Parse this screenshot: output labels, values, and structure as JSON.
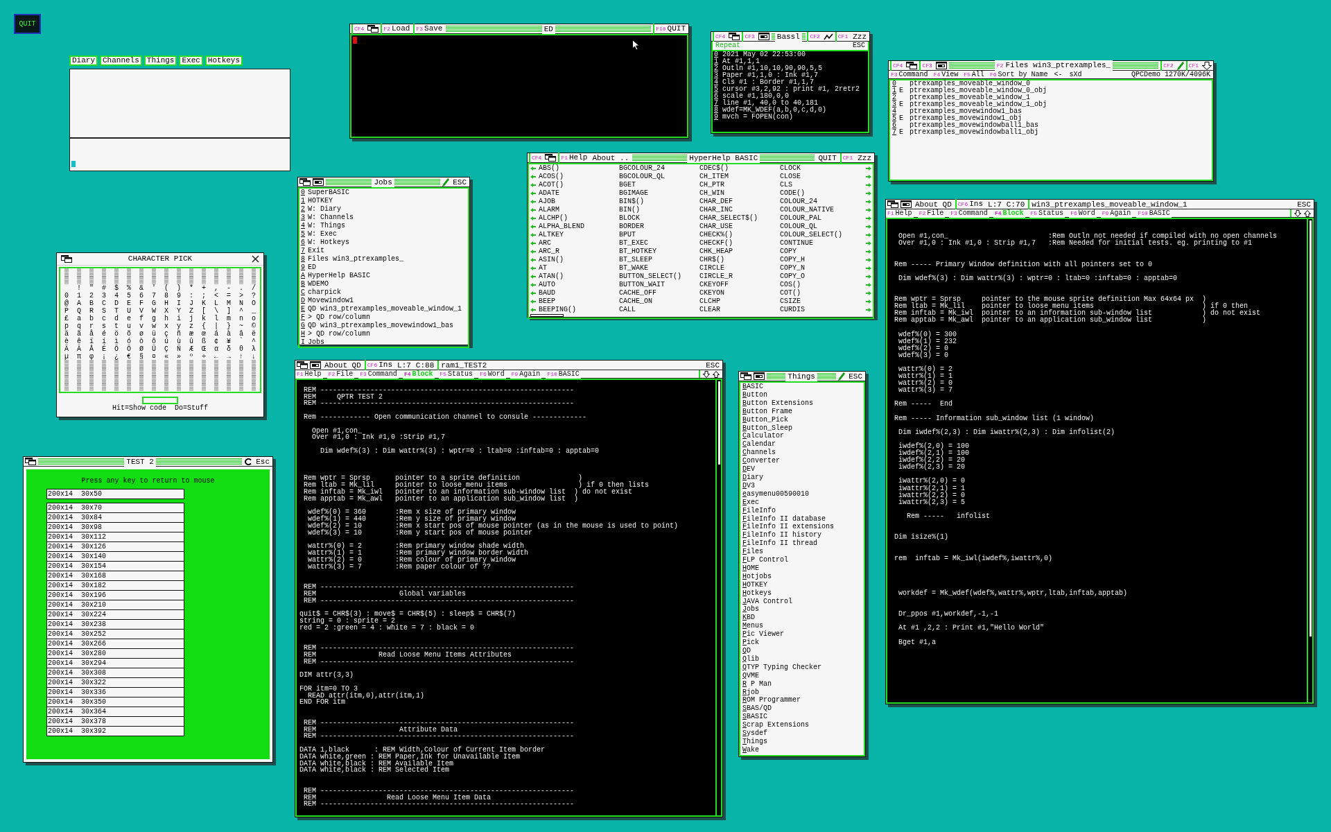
{
  "quit_button": {
    "label": "QUIT"
  },
  "diary_window": {
    "tabs": [
      "Diary",
      "Channels",
      "Things",
      "Exec",
      "Hotkeys"
    ]
  },
  "ed_window": {
    "header": [
      {
        "kind": "fkey",
        "key": "CF4"
      },
      {
        "kind": "wman"
      },
      {
        "kind": "fkey",
        "key": "F2",
        "label": "Load"
      },
      {
        "kind": "fkey",
        "key": "F3",
        "label": "Save"
      },
      {
        "kind": "title",
        "label": "ED"
      },
      {
        "kind": "fkey",
        "key": "F10",
        "label": "QUIT"
      }
    ]
  },
  "bassl_window": {
    "header": [
      {
        "kind": "fkey",
        "key": "CF4"
      },
      {
        "kind": "wman"
      },
      {
        "kind": "fkey",
        "key": "CF3"
      },
      {
        "kind": "card"
      },
      {
        "kind": "title",
        "label": "Bassl"
      },
      {
        "kind": "fkey",
        "key": "CF2"
      },
      {
        "kind": "resize"
      },
      {
        "kind": "fkey",
        "key": "CF1"
      },
      {
        "kind": "text",
        "label": "Zzz"
      }
    ],
    "subheader": {
      "label": "Repeat",
      "escape": "ESC"
    },
    "lines": [
      {
        "key": "0",
        "text": "2021 May 02 22:53:00"
      },
      {
        "key": "1",
        "text": "At #1,1,1"
      },
      {
        "key": "2",
        "text": "Outln #1,10,10,90,90,5,5"
      },
      {
        "key": "3",
        "text": "Paper #1,1,0 : Ink #1,7"
      },
      {
        "key": "4",
        "text": "Cls #1 : Border #1,1,7"
      },
      {
        "key": "5",
        "text": "cursor #3,2,92 : print #1, 2retr2"
      },
      {
        "key": "6",
        "text": "scale #1,180,0,0"
      },
      {
        "key": "7",
        "text": "line #1, 40,0 to 40,181"
      },
      {
        "key": "8",
        "text": "wdef=MK_WDEF(a,b,0,c,d,0)"
      },
      {
        "key": "9",
        "text": "mvch = FOPEN(con)"
      }
    ]
  },
  "files_window": {
    "header": [
      {
        "kind": "fkey",
        "key": "CF4"
      },
      {
        "kind": "wman"
      },
      {
        "kind": "fkey",
        "key": "CF3"
      },
      {
        "kind": "card"
      },
      {
        "kind": "title",
        "key": "F2",
        "label": "Files win3_ptrexamples_"
      },
      {
        "kind": "fkey",
        "key": "CF2"
      },
      {
        "kind": "pen"
      },
      {
        "kind": "fkey",
        "key": "CF1"
      },
      {
        "kind": "down"
      }
    ],
    "menu": [
      {
        "kind": "fkey",
        "key": "F3",
        "label": "Command"
      },
      {
        "kind": "fkey",
        "key": "F4",
        "label": "View"
      },
      {
        "kind": "fkey",
        "key": "F5",
        "label": "All"
      },
      {
        "kind": "fkey",
        "key": "F6",
        "label": "Sort by Name"
      },
      {
        "kind": "text",
        "label": "<-"
      },
      {
        "kind": "text",
        "label": "sXd"
      },
      {
        "kind": "text",
        "label": "QPCDemo 1270K/4096K"
      }
    ],
    "files": [
      {
        "key": "0",
        "name": "ptrexamples_moveable_window_0"
      },
      {
        "key": "1",
        "flag": "E",
        "name": "ptrexamples_moveable_window_0_obj"
      },
      {
        "key": "2",
        "name": "ptrexamples_moveable_window_1"
      },
      {
        "key": "3",
        "flag": "E",
        "name": "ptrexamples_moveable_window_1_obj"
      },
      {
        "key": "4",
        "name": "ptrexamples_movewindow1_bas"
      },
      {
        "key": "5",
        "flag": "E",
        "name": "ptrexamples_movewindow1_obj"
      },
      {
        "key": "6",
        "name": "ptrexamples_movewindowball1_bas"
      },
      {
        "key": "7",
        "flag": "E",
        "name": "ptrexamples_movewindowball1_obj"
      }
    ]
  },
  "hyperhelp_window": {
    "header": [
      {
        "kind": "fkey",
        "key": "CF4"
      },
      {
        "kind": "wman"
      },
      {
        "kind": "fkey",
        "key": "F1",
        "label": "Help"
      },
      {
        "kind": "text",
        "label": "About .."
      },
      {
        "kind": "title",
        "label": "HyperHelp BASIC"
      },
      {
        "kind": "text",
        "label": "QUIT"
      },
      {
        "kind": "fkey",
        "key": "CF1"
      },
      {
        "kind": "text",
        "label": "Zzz"
      }
    ],
    "rows": [
      [
        "ABS()",
        "BGCOLOUR_24",
        "CDEC$()",
        "CLOCK"
      ],
      [
        "ACOS()",
        "BGCOLOUR_QL",
        "CH_ITEM",
        "CLOSE"
      ],
      [
        "ACOT()",
        "BGET",
        "CH_PTR",
        "CLS"
      ],
      [
        "ADATE",
        "BGIMAGE",
        "CH_WIN",
        "CODE()"
      ],
      [
        "AJOB",
        "BIN$()",
        "CHAR_DEF",
        "COLOUR_24"
      ],
      [
        "ALARM",
        "BIN()",
        "CHAR_INC",
        "COLOUR_NATIVE"
      ],
      [
        "ALCHP()",
        "BLOCK",
        "CHAR_SELECT$()",
        "COLOUR_PAL"
      ],
      [
        "ALPHA_BLEND",
        "BORDER",
        "CHAR_USE",
        "COLOUR_QL"
      ],
      [
        "ALTKEY",
        "BPUT",
        "CHECK%()",
        "COLOUR_SELECT()"
      ],
      [
        "ARC",
        "BT_EXEC",
        "CHECKF()",
        "CONTINUE"
      ],
      [
        "ARC_R",
        "BT_HOTKEY",
        "CHK_HEAP",
        "COPY"
      ],
      [
        "ASIN()",
        "BT_SLEEP",
        "CHR$()",
        "COPY_H"
      ],
      [
        "AT",
        "BT_WAKE",
        "CIRCLE",
        "COPY_N"
      ],
      [
        "ATAN()",
        "BUTTON_SELECT()",
        "CIRCLE_R",
        "COPY_O"
      ],
      [
        "AUTO",
        "BUTTON_WAIT",
        "CKEYOFF",
        "COS()"
      ],
      [
        "BAUD",
        "CACHE_OFF",
        "CKEYON",
        "COT()"
      ],
      [
        "BEEP",
        "CACHE_ON",
        "CLCHP",
        "CSIZE"
      ],
      [
        "BEEPING()",
        "CALL",
        "CLEAR",
        "CURDIS"
      ]
    ]
  },
  "jobs_window": {
    "header": [
      {
        "kind": "wman"
      },
      {
        "kind": "card"
      },
      {
        "kind": "title",
        "label": "Jobs"
      },
      {
        "kind": "pen"
      },
      {
        "kind": "text",
        "label": "ESC"
      }
    ],
    "jobs": [
      {
        "key": "0",
        "label": "SuperBASIC"
      },
      {
        "key": "1",
        "label": "HOTKEY"
      },
      {
        "key": "2",
        "label": "W: Diary"
      },
      {
        "key": "3",
        "label": "W: Channels"
      },
      {
        "key": "4",
        "label": "W: Things"
      },
      {
        "key": "5",
        "label": "W: Exec"
      },
      {
        "key": "6",
        "label": "W: Hotkeys"
      },
      {
        "key": "7",
        "label": "Exit"
      },
      {
        "key": "8",
        "label": "Files win3_ptrexamples_"
      },
      {
        "key": "9",
        "label": "ED"
      },
      {
        "key": "A",
        "label": "HyperHelp BASIC"
      },
      {
        "key": "B",
        "label": "WDEMO"
      },
      {
        "key": "C",
        "label": "charpick"
      },
      {
        "key": "D",
        "label": "Movewindow1"
      },
      {
        "key": "E",
        "label": "QD win3_ptrexamples_moveable_window_1"
      },
      {
        "key": "F",
        "label": "> QD row/column"
      },
      {
        "key": "G",
        "label": "QD win3_ptrexamples_movewindow1_bas"
      },
      {
        "key": "H",
        "label": "> QD row/column"
      },
      {
        "key": "I",
        "label": "Jobs"
      }
    ]
  },
  "charpick_window": {
    "title": "CHARACTER PICK",
    "rows": [
      "▒ ▒ ▒ ▒ ▒ ▒ ▒ ▒ ▒ ▒ ▒ ▒ ▒ ▒ ▒ ▒",
      "▒ ▒ ▒ ▒ ▒ ▒ ▒ ▒ ▒ ▒ ▒ ▒ ▒ ▒ ▒ ▒",
      "  ! \" # $ % & ' ( ) * + , - . /",
      "0 1 2 3 4 5 6 7 8 9 : ; < = > ?",
      "@ A B C D E F G H I J K L M N O",
      "P Q R S T U V W X Y Z [ \\ ] ^ _",
      "£ a b c d e f g h i j k l m n o",
      "p q r s t u v w x y z { | } ~ ©",
      "ä ã å é ö õ ø ü ç ñ æ œ á à â ë",
      "è ê ï í ì ó ò ô ú ù û ß ¢ ¥ ` ^",
      "Ä Ã Å É Ö Õ Ø Ü Ç Ñ Æ Œ α δ θ λ",
      "µ π φ ¡ ¿ € § ¤ « » º ÷ ← → ↑ ↓",
      "▒ ▒ ▒ ▒ ▒ ▒ ▒ ▒ ▒ ▒ ▒ ▒ ▒ ▒ ▒ ▒",
      "▒ ▒ ▒ ▒ ▒ ▒ ▒ ▒ ▒ ▒ ▒ ▒ ▒ ▒ ▒ ▒",
      "▒ ▒ ▒ ▒ ▒ ▒ ▒ ▒ ▒ ▒ ▒ ▒ ▒ ▒ ▒ ▒",
      "▒ ▒ ▒ ▒ ▒ ▒ ▒ ▒ ▒ ▒ ▒ ▒ ▒ ▒ ▒ ▒"
    ],
    "hint": "Hit=Show code  Do=Stuff"
  },
  "test2_window": {
    "header": [
      {
        "kind": "wman"
      },
      {
        "kind": "title",
        "label": "TEST 2"
      },
      {
        "kind": "refresh"
      },
      {
        "kind": "text",
        "label": "Esc"
      }
    ],
    "prompt": "Press any key to return to mouse",
    "top_items": [
      "200x14  30x50"
    ],
    "items": [
      "200x14  30x70",
      "200x14  30x84",
      "200x14  30x98",
      "200x14  30x112",
      "200x14  30x126",
      "200x14  30x140",
      "200x14  30x154",
      "200x14  30x168",
      "200x14  30x182",
      "200x14  30x196",
      "200x14  30x210",
      "200x14  30x224",
      "200x14  30x238",
      "200x14  30x252",
      "200x14  30x266",
      "200x14  30x280",
      "200x14  30x294",
      "200x14  30x308",
      "200x14  30x322",
      "200x14  30x336",
      "200x14  30x350",
      "200x14  30x364",
      "200x14  30x378",
      "200x14  30x392"
    ]
  },
  "things_window": {
    "header": [
      {
        "kind": "wman"
      },
      {
        "kind": "card"
      },
      {
        "kind": "title",
        "label": "Things"
      },
      {
        "kind": "pen"
      },
      {
        "kind": "text",
        "label": "ESC"
      }
    ],
    "things": [
      "BASIC",
      "Button",
      "Button Extensions",
      "Button Frame",
      "Button_Pick",
      "Button_Sleep",
      "Calculator",
      "Calendar",
      "Channels",
      "Converter",
      "DEV",
      "Diary",
      "DV3",
      "easymenu00590010",
      "Exec",
      "FileInfo",
      "FileInfo II database",
      "FileInfo II extensions",
      "FileInfo II history",
      "FileInfo II thread",
      "Files",
      "FLP Control",
      "HOME",
      "Hotjobs",
      "HOTKEY",
      "Hotkeys",
      "JAVA Control",
      "Jobs",
      "KBD",
      "Menus",
      "Pic Viewer",
      "Pick",
      "QD",
      "Qlib",
      "QTYP Typing Checker",
      "QVME",
      "R P Man",
      "Rjob",
      "ROM Programmer",
      "SBAS/QD",
      "SBASIC",
      "Scrap Extensions",
      "Sysdef",
      "Things",
      "Wake"
    ]
  },
  "editor_windows": [
    {
      "header": [
        {
          "kind": "wman"
        },
        {
          "kind": "card"
        },
        {
          "kind": "text",
          "label": "About QD"
        },
        {
          "kind": "fkey",
          "key": "CF6",
          "label": "Ins"
        },
        {
          "kind": "text",
          "label": "L:7"
        },
        {
          "kind": "text",
          "label": "C:88"
        },
        {
          "kind": "file",
          "label": "ram1_TEST2"
        },
        {
          "kind": "text",
          "label": "ESC"
        }
      ],
      "menu": [
        {
          "key": "F1",
          "label": "Help",
          "highlighted": false
        },
        {
          "key": "F2",
          "label": "File",
          "highlighted": false
        },
        {
          "key": "F3",
          "label": "Command",
          "highlighted": false
        },
        {
          "key": "F4",
          "label": "Block",
          "highlighted": true
        },
        {
          "key": "F5",
          "label": "Status",
          "highlighted": false
        },
        {
          "key": "F6",
          "label": "Word",
          "highlighted": false
        },
        {
          "key": "F9",
          "label": "Again",
          "highlighted": false
        },
        {
          "key": "F10",
          "label": "BASIC",
          "highlighted": false
        }
      ],
      "lines": [
        {
          "kind": "blank"
        },
        {
          "kind": "code",
          "text": " REM -------------------------------------------------------------"
        },
        {
          "kind": "code",
          "text": " REM     QPTR TEST 2"
        },
        {
          "kind": "code",
          "text": " REM -------------------------------------------------------------"
        },
        {
          "kind": "blank"
        },
        {
          "kind": "code",
          "text": " Rem ------------ Open communication channel to consule -------------"
        },
        {
          "kind": "blank"
        },
        {
          "kind": "code",
          "text": "   Open #1,con_"
        },
        {
          "kind": "code",
          "text": "   Over #1,0 : Ink #1,0 :Strip #1,7"
        },
        {
          "kind": "blank"
        },
        {
          "kind": "code",
          "text": "     Dim wdef%(3) : Dim wattr%(3) : wptr=0 : ltab=0 :inftab=0 : apptab=0"
        },
        {
          "kind": "blank"
        },
        {
          "kind": "blank"
        },
        {
          "kind": "blank"
        },
        {
          "kind": "code",
          "text": " Rem wptr = Sprsp      pointer to a sprite definition              )"
        },
        {
          "kind": "code",
          "text": " Rem ltab = Mk_lil     pointer to loose menu items                 ) if 0 then lists"
        },
        {
          "kind": "code",
          "text": " Rem inftab = Mk_iwl   pointer to an information sub-window list  ) do not exist"
        },
        {
          "kind": "code",
          "text": " Rem apptab = Mk_awl   pointer to an application sub_window list  )"
        },
        {
          "kind": "blank"
        },
        {
          "kind": "code",
          "text": "  wdef%(0) = 360       :Rem x size of primary window"
        },
        {
          "kind": "code",
          "text": "  wdef%(1) = 440       :Rem y size of primary window"
        },
        {
          "kind": "code",
          "text": "  wdef%(2) = 10        :Rem x start pos of mouse pointer (as in the mouse is used to point)"
        },
        {
          "kind": "code",
          "text": "  wdef%(3) = 10        :Rem y start pos of mouse pointer"
        },
        {
          "kind": "blank"
        },
        {
          "kind": "code",
          "text": "  wattr%(0) = 2        :Rem primary window shade width"
        },
        {
          "kind": "code",
          "text": "  wattr%(1) = 1        :Rem primary window border width"
        },
        {
          "kind": "code",
          "text": "  wattr%(2) = 0        :Rem colour of primary window"
        },
        {
          "kind": "code",
          "text": "  wattr%(3) = 7        :Rem paper colour of ??"
        },
        {
          "kind": "blank"
        },
        {
          "kind": "blank"
        },
        {
          "kind": "code",
          "text": " REM -------------------------------------------------------------"
        },
        {
          "kind": "code",
          "text": " REM                    Global variables"
        },
        {
          "kind": "code",
          "text": " REM -------------------------------------------------------------"
        },
        {
          "kind": "blank"
        },
        {
          "kind": "code",
          "text": "quit$ = CHR$(3) : move$ = CHR$(5) : sleep$ = CHR$(7)"
        },
        {
          "kind": "code",
          "text": "string = 0 : sprite = 2"
        },
        {
          "kind": "code",
          "text": "red = 2 :green = 4 : white = 7 : black = 0"
        },
        {
          "kind": "blank"
        },
        {
          "kind": "blank"
        },
        {
          "kind": "code",
          "text": " REM -------------------------------------------------------------"
        },
        {
          "kind": "code",
          "text": " REM               Read Loose Menu Items Attributes"
        },
        {
          "kind": "code",
          "text": " REM -------------------------------------------------------------"
        },
        {
          "kind": "blank"
        },
        {
          "kind": "code",
          "text": "DIM attr(3,3)"
        },
        {
          "kind": "blank"
        },
        {
          "kind": "code",
          "text": "FOR itm=0 TO 3"
        },
        {
          "kind": "code",
          "text": "  READ attr(itm,0),attr(itm,1)"
        },
        {
          "kind": "code",
          "text": "END FOR itm"
        },
        {
          "kind": "blank"
        },
        {
          "kind": "blank"
        },
        {
          "kind": "code",
          "text": " REM -------------------------------------------------------------"
        },
        {
          "kind": "code",
          "text": " REM                    Attribute Data"
        },
        {
          "kind": "code",
          "text": " REM -------------------------------------------------------------"
        },
        {
          "kind": "blank"
        },
        {
          "kind": "code",
          "text": "DATA 1,black      : REM Width,Colour of Current Item border"
        },
        {
          "kind": "code",
          "text": "DATA white,green : REM Paper,Ink for Unavailable Item"
        },
        {
          "kind": "code",
          "text": "DATA white,black : REM Available Item"
        },
        {
          "kind": "code",
          "text": "DATA white,black : REM Selected Item"
        },
        {
          "kind": "blank"
        },
        {
          "kind": "blank"
        },
        {
          "kind": "code",
          "text": " REM -------------------------------------------------------------"
        },
        {
          "kind": "code",
          "text": " REM                 Read Loose Menu Item Data"
        },
        {
          "kind": "code",
          "text": " REM -------------------------------------------------------------"
        }
      ]
    },
    {
      "header": [
        {
          "kind": "wman"
        },
        {
          "kind": "card"
        },
        {
          "kind": "text",
          "label": "About QD"
        },
        {
          "kind": "fkey",
          "key": "CF6",
          "label": "Ins"
        },
        {
          "kind": "text",
          "label": "L:7"
        },
        {
          "kind": "text",
          "label": "C:70"
        },
        {
          "kind": "file",
          "label": "win3_ptrexamples_moveable_window_1"
        },
        {
          "kind": "text",
          "label": "ESC"
        }
      ],
      "menu": [
        {
          "key": "F1",
          "label": "Help",
          "highlighted": false
        },
        {
          "key": "F2",
          "label": "File",
          "highlighted": false
        },
        {
          "key": "F3",
          "label": "Command",
          "highlighted": false
        },
        {
          "key": "F4",
          "label": "Block",
          "highlighted": true
        },
        {
          "key": "F5",
          "label": "Status",
          "highlighted": false
        },
        {
          "key": "F6",
          "label": "Word",
          "highlighted": false
        },
        {
          "key": "F9",
          "label": "Again",
          "highlighted": false
        },
        {
          "key": "F10",
          "label": "BASIC",
          "highlighted": false
        }
      ],
      "lines": [
        {
          "kind": "blank"
        },
        {
          "kind": "blank"
        },
        {
          "kind": "code",
          "text": "  Open #1,con_                        :Rem Outln not needed if compiled with no open channels"
        },
        {
          "kind": "code",
          "text": "  Over #1,0 : Ink #1,0 : Strip #1,7   :Rem Needed for initial tests. eg. printing to #1"
        },
        {
          "kind": "blank"
        },
        {
          "kind": "blank"
        },
        {
          "kind": "code",
          "text": " Rem ----- Primary Window definition with all pointers set to 0"
        },
        {
          "kind": "blank"
        },
        {
          "kind": "code",
          "text": "  Dim wdef%(3) : Dim wattr%(3) : wptr=0 : ltab=0 :inftab=0 : apptab=0"
        },
        {
          "kind": "blank"
        },
        {
          "kind": "blank"
        },
        {
          "kind": "code",
          "text": " Rem wptr = Sprsp     pointer to the mouse sprite definition Max 64x64 px  )"
        },
        {
          "kind": "code",
          "text": " Rem ltab = Mk_lil    pointer to loose menu items                          ) if 0 then"
        },
        {
          "kind": "code",
          "text": " Rem inftab = Mk_iwl  pointer to an information sub-window list            ) do not exist"
        },
        {
          "kind": "code",
          "text": " Rem apptab = Mk_awl  pointer to an application sub_window list            )"
        },
        {
          "kind": "blank"
        },
        {
          "kind": "code",
          "text": "  wdef%(0) = 300"
        },
        {
          "kind": "code",
          "text": "  wdef%(1) = 232"
        },
        {
          "kind": "code",
          "text": "  wdef%(2) = 0"
        },
        {
          "kind": "code",
          "text": "  wdef%(3) = 0"
        },
        {
          "kind": "blank"
        },
        {
          "kind": "code",
          "text": "  wattr%(0) = 2"
        },
        {
          "kind": "code",
          "text": "  wattr%(1) = 1"
        },
        {
          "kind": "code",
          "text": "  wattr%(2) = 0"
        },
        {
          "kind": "code",
          "text": "  wattr%(3) = 7"
        },
        {
          "kind": "blank"
        },
        {
          "kind": "code",
          "text": " Rem -----  End"
        },
        {
          "kind": "blank"
        },
        {
          "kind": "code",
          "text": " Rem ----- Information sub_window list (1 window)"
        },
        {
          "kind": "blank"
        },
        {
          "kind": "code",
          "text": "  Dim iwdef%(2,3) : Dim iwattr%(2,3) : Dim infolist(2)"
        },
        {
          "kind": "blank"
        },
        {
          "kind": "code",
          "text": "  iwdef%(2,0) = 100"
        },
        {
          "kind": "code",
          "text": "  iwdef%(2,1) = 100"
        },
        {
          "kind": "code",
          "text": "  iwdef%(2,2) = 20"
        },
        {
          "kind": "code",
          "text": "  iwdef%(2,3) = 20"
        },
        {
          "kind": "blank"
        },
        {
          "kind": "code",
          "text": "  iwattr%(2,0) = 0"
        },
        {
          "kind": "code",
          "text": "  iwattr%(2,1) = 1"
        },
        {
          "kind": "code",
          "text": "  iwattr%(2,2) = 0"
        },
        {
          "kind": "code",
          "text": "  iwattr%(2,3) = 5"
        },
        {
          "kind": "blank"
        },
        {
          "kind": "code",
          "text": "    Rem -----   infolist"
        },
        {
          "kind": "blank"
        },
        {
          "kind": "blank"
        },
        {
          "kind": "code",
          "text": " Dim isize%(1)"
        },
        {
          "kind": "blank"
        },
        {
          "kind": "blank"
        },
        {
          "kind": "code",
          "text": " rem  inftab = Mk_iwl(iwdef%,iwattr%,0)"
        },
        {
          "kind": "blank"
        },
        {
          "kind": "blank"
        },
        {
          "kind": "blank"
        },
        {
          "kind": "blank"
        },
        {
          "kind": "code",
          "text": "  workdef = Mk_wdef(wdef%,wattr%,wptr,ltab,inftab,apptab)"
        },
        {
          "kind": "blank"
        },
        {
          "kind": "blank"
        },
        {
          "kind": "code",
          "text": "  Dr_ppos #1,workdef,-1,-1"
        },
        {
          "kind": "blank"
        },
        {
          "kind": "code",
          "text": "  At #1 ,2,2 : Print #1,\"Hello World\""
        },
        {
          "kind": "blank"
        },
        {
          "kind": "code",
          "text": "  Bget #1,a"
        }
      ]
    }
  ]
}
